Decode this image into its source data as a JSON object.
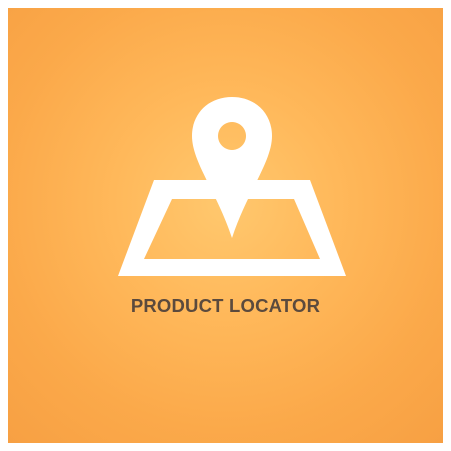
{
  "title": "PRODUCT LOCATOR",
  "icon": "map-pin-icon",
  "colors": {
    "background": "#fbac4d",
    "icon": "#ffffff",
    "text": "#5b4a3d"
  }
}
